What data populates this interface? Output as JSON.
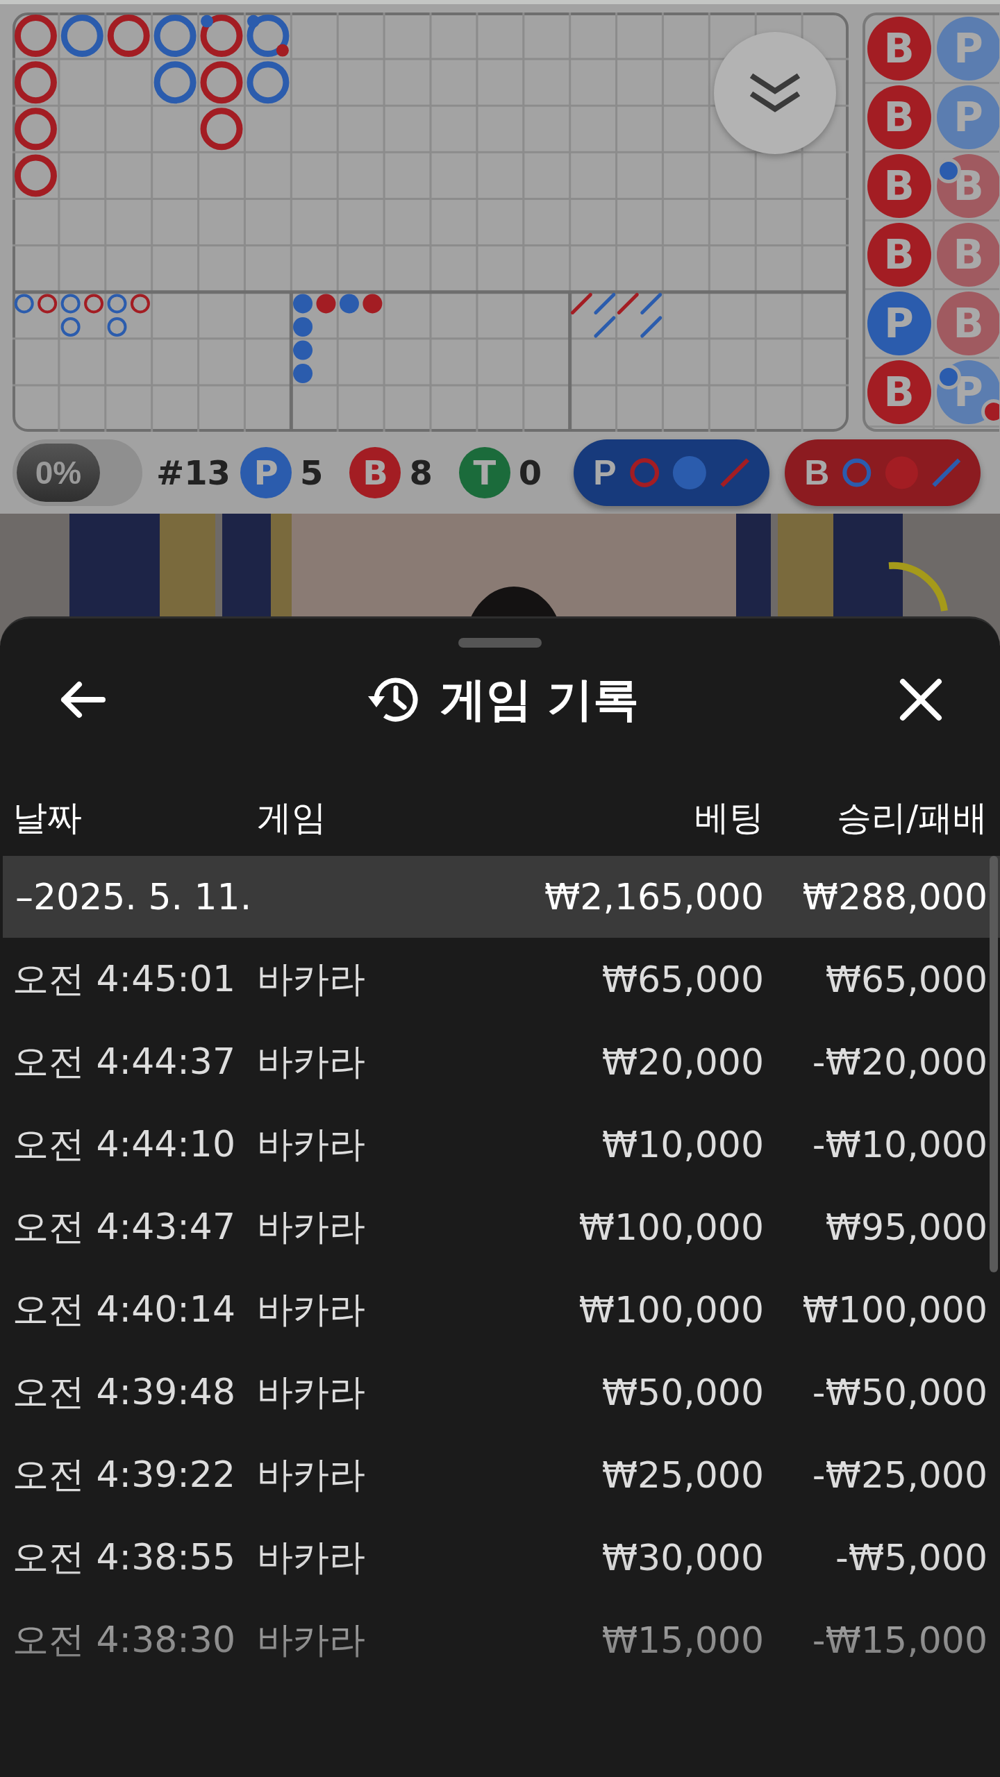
{
  "roadmap": {
    "big_road": [
      [
        {
          "color": "#a31d23"
        },
        {
          "color": "#a31d23"
        },
        {
          "color": "#a31d23"
        },
        {
          "color": "#a31d23"
        }
      ],
      [
        {
          "color": "#2b5cad"
        }
      ],
      [
        {
          "color": "#a31d23"
        }
      ],
      [
        {
          "color": "#2b5cad"
        },
        {
          "color": "#2b5cad"
        }
      ],
      [
        {
          "color": "#a31d23",
          "player_pair": true
        },
        {
          "color": "#a31d23"
        },
        {
          "color": "#a31d23"
        }
      ],
      [
        {
          "color": "#2b5cad",
          "player_pair": true,
          "banker_pair": true
        },
        {
          "color": "#2b5cad"
        }
      ]
    ],
    "big_eye_road": [
      [
        {
          "color": "#2b5cad"
        }
      ],
      [
        {
          "color": "#a31d23"
        }
      ],
      [
        {
          "color": "#2b5cad"
        },
        {
          "color": "#2b5cad"
        }
      ],
      [
        {
          "color": "#a31d23"
        }
      ],
      [
        {
          "color": "#2b5cad"
        },
        {
          "color": "#2b5cad"
        }
      ],
      [
        {
          "color": "#a31d23"
        }
      ]
    ],
    "small_road": [
      [
        {
          "color": "#2b5cad"
        },
        {
          "color": "#2b5cad"
        },
        {
          "color": "#2b5cad"
        },
        {
          "color": "#2b5cad"
        }
      ],
      [
        {
          "color": "#a31d23"
        }
      ],
      [
        {
          "color": "#2b5cad"
        }
      ],
      [
        {
          "color": "#a31d23"
        }
      ]
    ],
    "cockroach_road": [
      [
        {
          "color": "#a31d23"
        }
      ],
      [
        {
          "color": "#2b5cad"
        },
        {
          "color": "#2b5cad"
        }
      ],
      [
        {
          "color": "#a31d23"
        }
      ],
      [
        {
          "color": "#2b5cad"
        },
        {
          "color": "#2b5cad"
        }
      ]
    ],
    "bead_road": [
      [
        {
          "label": "B",
          "color": "#a31d23"
        },
        {
          "label": "B",
          "color": "#a31d23"
        },
        {
          "label": "B",
          "color": "#a31d23"
        },
        {
          "label": "B",
          "color": "#a31d23"
        },
        {
          "label": "P",
          "color": "#2b5cad"
        },
        {
          "label": "B",
          "color": "#a31d23"
        }
      ],
      [
        {
          "label": "P",
          "color": "#5b7db0"
        },
        {
          "label": "P",
          "color": "#5b7db0"
        },
        {
          "label": "B",
          "color": "#a05a60",
          "player_pair": true
        },
        {
          "label": "B",
          "color": "#a05a60"
        },
        {
          "label": "B",
          "color": "#a05a60"
        },
        {
          "label": "P",
          "color": "#5b7db0",
          "player_pair": true,
          "banker_pair": true
        }
      ]
    ]
  },
  "stats": {
    "toggle": "0%",
    "round": "#13",
    "counts": [
      {
        "label": "P",
        "color": "#2b5cad",
        "value": "5"
      },
      {
        "label": "B",
        "color": "#a31d23",
        "value": "8"
      },
      {
        "label": "T",
        "color": "#1b6b3b",
        "value": "0"
      }
    ],
    "predictions": [
      {
        "label": "P",
        "color": "#173a7c",
        "marks": [
          {
            "kind": "ring",
            "color": "#a31d23"
          },
          {
            "kind": "dot",
            "color": "#2b5cad"
          },
          {
            "kind": "slash",
            "color": "#a31d23"
          }
        ]
      },
      {
        "label": "B",
        "color": "#8c1b20",
        "marks": [
          {
            "kind": "ring",
            "color": "#2b5cad"
          },
          {
            "kind": "dot",
            "color": "#a31d23"
          },
          {
            "kind": "slash",
            "color": "#2b5cad"
          }
        ]
      }
    ]
  },
  "sheet": {
    "title": "게임 기록",
    "columns": [
      "날짜",
      "게임",
      "베팅",
      "승리/패배"
    ],
    "group": {
      "date": "–2025. 5. 11.",
      "bet": "₩2,165,000",
      "result": "₩288,000"
    },
    "rows": [
      {
        "time": "오전 4:45:01",
        "game": "바카라",
        "bet": "₩65,000",
        "result": "₩65,000"
      },
      {
        "time": "오전 4:44:37",
        "game": "바카라",
        "bet": "₩20,000",
        "result": "-₩20,000"
      },
      {
        "time": "오전 4:44:10",
        "game": "바카라",
        "bet": "₩10,000",
        "result": "-₩10,000"
      },
      {
        "time": "오전 4:43:47",
        "game": "바카라",
        "bet": "₩100,000",
        "result": "₩95,000"
      },
      {
        "time": "오전 4:40:14",
        "game": "바카라",
        "bet": "₩100,000",
        "result": "₩100,000"
      },
      {
        "time": "오전 4:39:48",
        "game": "바카라",
        "bet": "₩50,000",
        "result": "-₩50,000"
      },
      {
        "time": "오전 4:39:22",
        "game": "바카라",
        "bet": "₩25,000",
        "result": "-₩25,000"
      },
      {
        "time": "오전 4:38:55",
        "game": "바카라",
        "bet": "₩30,000",
        "result": "-₩5,000"
      },
      {
        "time": "오전 4:38:30",
        "game": "바카라",
        "bet": "₩15,000",
        "result": "-₩15,000"
      }
    ]
  }
}
